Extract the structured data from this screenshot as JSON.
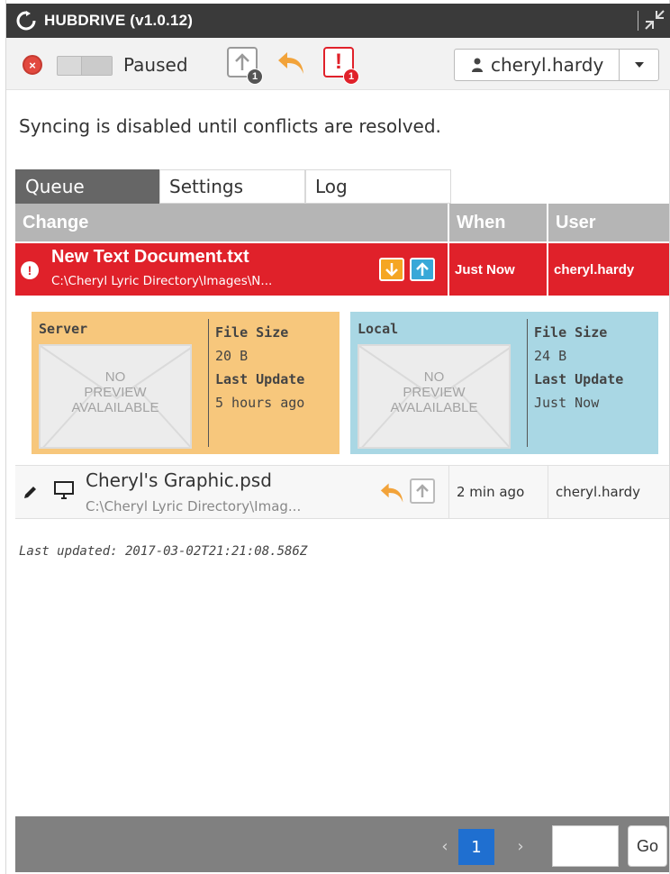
{
  "app": {
    "title": "HUBDRIVE (v1.0.12)"
  },
  "toolbar": {
    "status_label": "Paused",
    "upload_badge": "1",
    "conflict_badge": "1",
    "user": "cheryl.hardy"
  },
  "message": "Syncing is disabled until conflicts are resolved.",
  "tabs": [
    {
      "label": "Queue",
      "active": true
    },
    {
      "label": "Settings",
      "active": false
    },
    {
      "label": "Log",
      "active": false
    }
  ],
  "table": {
    "headers": {
      "change": "Change",
      "when": "When",
      "user": "User"
    },
    "rows": [
      {
        "name": "New Text Document.txt",
        "path": "C:\\Cheryl Lyric Directory\\Images\\N...",
        "when": "Just Now",
        "user": "cheryl.hardy",
        "status": "conflict"
      },
      {
        "name": "Cheryl's Graphic.psd",
        "path": "C:\\Cheryl Lyric Directory\\Imag...",
        "when": "2 min ago",
        "user": "cheryl.hardy",
        "status": "pending"
      }
    ]
  },
  "compare": {
    "server": {
      "label": "Server",
      "preview": [
        "NO",
        "PREVIEW",
        "AVALAILABLE"
      ],
      "file_size_label": "File Size",
      "file_size": "20 B",
      "last_update_label": "Last Update",
      "last_update": "5 hours ago"
    },
    "local": {
      "label": "Local",
      "preview": [
        "NO",
        "PREVIEW",
        "AVALAILABLE"
      ],
      "file_size_label": "File Size",
      "file_size": "24 B",
      "last_update_label": "Last Update",
      "last_update": "Just Now"
    }
  },
  "last_updated": "Last updated: 2017-03-02T21:21:08.586Z",
  "pager": {
    "prev": "‹",
    "current": "1",
    "next": "›",
    "go_label": "Go"
  },
  "colors": {
    "conflict_red": "#e0212a",
    "server_orange": "#f7c77c",
    "local_blue": "#a9d7e4",
    "active_page": "#1f6fd0",
    "titlebar": "#3a3a3a"
  },
  "icons": {
    "titlebar_logo": "sync-icon",
    "collapse": "collapse-icon",
    "status": "close-circle-icon",
    "upload": "upload-icon",
    "revert": "undo-icon",
    "conflicts": "alert-icon",
    "user": "user-icon",
    "caret": "caret-down-icon",
    "row_edit": "pencil-icon",
    "row_device": "monitor-icon",
    "download": "arrow-down-icon",
    "upload_row": "arrow-up-icon"
  }
}
